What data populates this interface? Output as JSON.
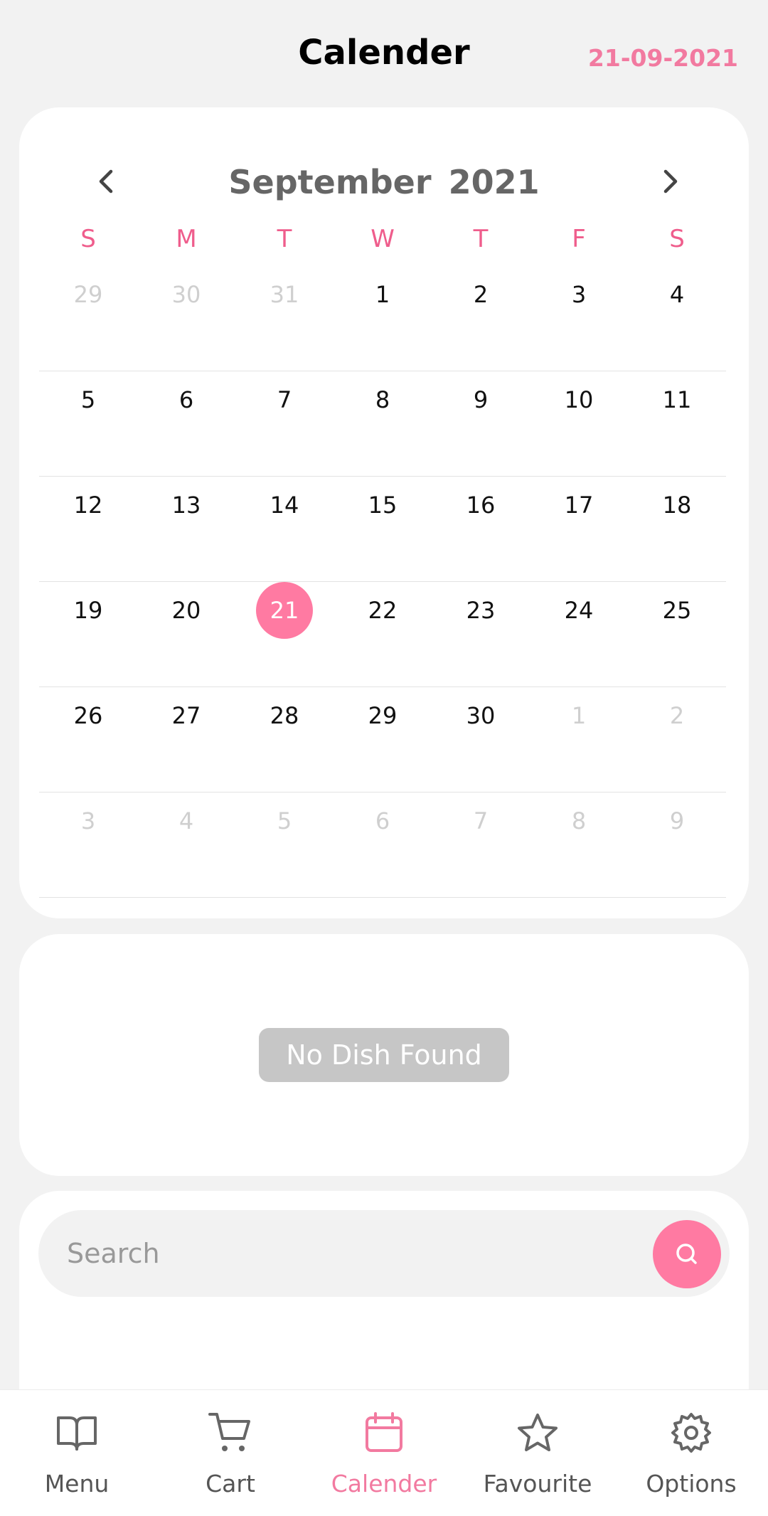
{
  "header": {
    "title": "Calender",
    "date": "21-09-2021"
  },
  "calendar": {
    "month_label": "September  2021",
    "weekdays": [
      "S",
      "M",
      "T",
      "W",
      "T",
      "F",
      "S"
    ],
    "weeks": [
      [
        {
          "d": "29",
          "m": true
        },
        {
          "d": "30",
          "m": true
        },
        {
          "d": "31",
          "m": true
        },
        {
          "d": "1"
        },
        {
          "d": "2"
        },
        {
          "d": "3"
        },
        {
          "d": "4"
        }
      ],
      [
        {
          "d": "5"
        },
        {
          "d": "6"
        },
        {
          "d": "7"
        },
        {
          "d": "8"
        },
        {
          "d": "9"
        },
        {
          "d": "10"
        },
        {
          "d": "11"
        }
      ],
      [
        {
          "d": "12"
        },
        {
          "d": "13"
        },
        {
          "d": "14"
        },
        {
          "d": "15"
        },
        {
          "d": "16"
        },
        {
          "d": "17"
        },
        {
          "d": "18"
        }
      ],
      [
        {
          "d": "19"
        },
        {
          "d": "20"
        },
        {
          "d": "21",
          "sel": true
        },
        {
          "d": "22"
        },
        {
          "d": "23"
        },
        {
          "d": "24"
        },
        {
          "d": "25"
        }
      ],
      [
        {
          "d": "26"
        },
        {
          "d": "27"
        },
        {
          "d": "28"
        },
        {
          "d": "29"
        },
        {
          "d": "30"
        },
        {
          "d": "1",
          "m": true
        },
        {
          "d": "2",
          "m": true
        }
      ],
      [
        {
          "d": "3",
          "m": true
        },
        {
          "d": "4",
          "m": true
        },
        {
          "d": "5",
          "m": true
        },
        {
          "d": "6",
          "m": true
        },
        {
          "d": "7",
          "m": true
        },
        {
          "d": "8",
          "m": true
        },
        {
          "d": "9",
          "m": true
        }
      ]
    ]
  },
  "dishes": {
    "empty_label": "No Dish Found"
  },
  "search": {
    "placeholder": "Search",
    "value": ""
  },
  "tabs": [
    {
      "label": "Menu",
      "icon": "book-open-icon"
    },
    {
      "label": "Cart",
      "icon": "cart-icon"
    },
    {
      "label": "Calender",
      "icon": "calendar-icon"
    },
    {
      "label": "Favourite",
      "icon": "star-icon"
    },
    {
      "label": "Options",
      "icon": "gear-icon"
    }
  ],
  "colors": {
    "accent": "#ff7aa2",
    "accent_text": "#f27aa0",
    "muted": "#cfcfcf",
    "background": "#f2f2f2"
  }
}
